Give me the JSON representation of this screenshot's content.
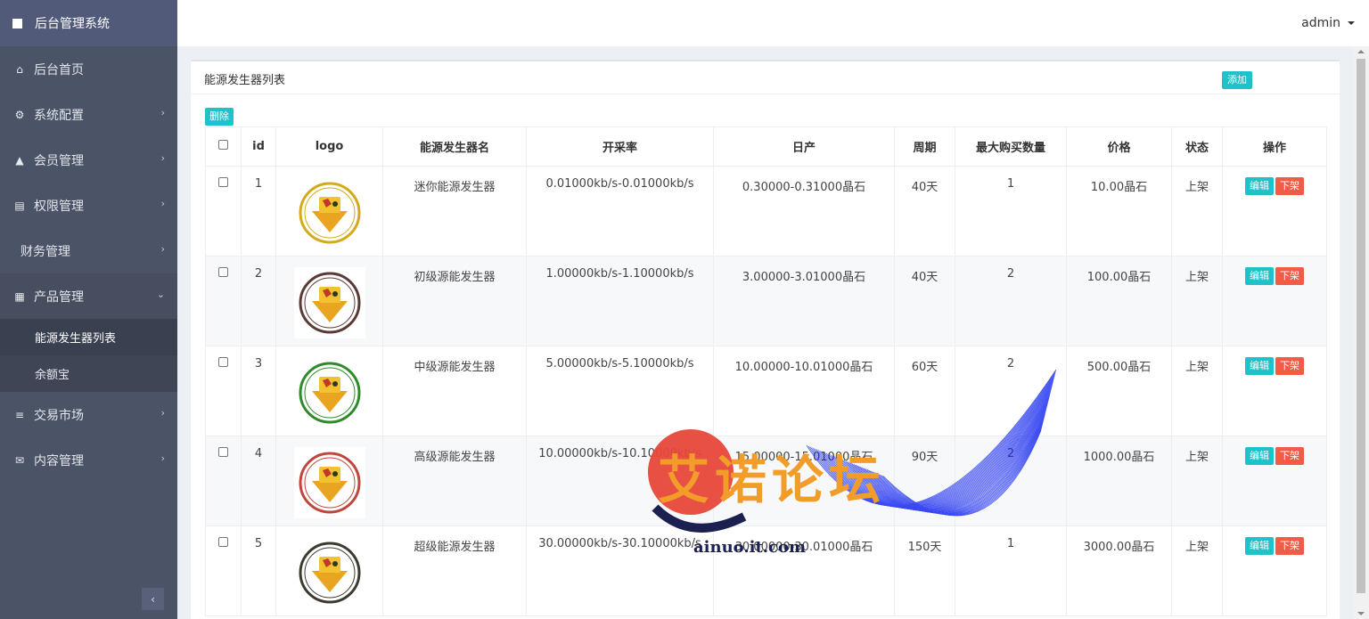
{
  "brand": {
    "title": "后台管理系统"
  },
  "topbar": {
    "user": "admin"
  },
  "sidebar": {
    "items": [
      {
        "label": "后台首页",
        "icon": "home-icon",
        "glyph": "⌂"
      },
      {
        "label": "系统配置",
        "icon": "cogs-icon",
        "glyph": "⚙"
      },
      {
        "label": "会员管理",
        "icon": "user-icon",
        "glyph": "▲"
      },
      {
        "label": "权限管理",
        "icon": "list-icon",
        "glyph": "▤"
      },
      {
        "label": "财务管理",
        "icon": "",
        "glyph": ""
      },
      {
        "label": "产品管理",
        "icon": "windows-icon",
        "glyph": "▦"
      },
      {
        "label": "交易市场",
        "icon": "bars-icon",
        "glyph": "≡"
      },
      {
        "label": "内容管理",
        "icon": "envelope-icon",
        "glyph": "✉"
      }
    ],
    "submenu": [
      {
        "label": "能源发生器列表"
      },
      {
        "label": "余额宝"
      }
    ],
    "collapse": "‹"
  },
  "panel": {
    "title": "能源发生器列表",
    "add_label": "添加",
    "delete_label": "删除"
  },
  "table": {
    "headers": [
      "",
      "id",
      "logo",
      "能源发生器名",
      "开采率",
      "日产",
      "周期",
      "最大购买数量",
      "价格",
      "状态",
      "操作"
    ],
    "edit_label": "编辑",
    "offshelf_label": "下架",
    "rows": [
      {
        "id": "1",
        "name": "迷你能源发生器",
        "rate": "0.01000kb/s-0.01000kb/s",
        "daily": "0.30000-0.31000晶石",
        "period": "40天",
        "max": "1",
        "price": "10.00晶石",
        "status": "上架",
        "ring": "#d4aa1a"
      },
      {
        "id": "2",
        "name": "初级源能发生器",
        "rate": "1.00000kb/s-1.10000kb/s",
        "daily": "3.00000-3.01000晶石",
        "period": "40天",
        "max": "2",
        "price": "100.00晶石",
        "status": "上架",
        "ring": "#5a3a36"
      },
      {
        "id": "3",
        "name": "中级源能发生器",
        "rate": "5.00000kb/s-5.10000kb/s",
        "daily": "10.00000-10.01000晶石",
        "period": "60天",
        "max": "2",
        "price": "500.00晶石",
        "status": "上架",
        "ring": "#2f8a2a"
      },
      {
        "id": "4",
        "name": "高级源能发生器",
        "rate": "10.00000kb/s-10.10000kb/s",
        "daily": "15.00000-15.01000晶石",
        "period": "90天",
        "max": "2",
        "price": "1000.00晶石",
        "status": "上架",
        "ring": "#c0463c"
      },
      {
        "id": "5",
        "name": "超级能源发生器",
        "rate": "30.00000kb/s-30.10000kb/s",
        "daily": "30.00000-30.01000晶石",
        "period": "150天",
        "max": "1",
        "price": "3000.00晶石",
        "status": "上架",
        "ring": "#3d3a30"
      }
    ]
  },
  "watermark": {
    "text": "艾诺论坛",
    "url": "ainuo.it.com"
  },
  "colors": {
    "sidebar": "#4b5366",
    "brand": "#525a7a",
    "teal": "#1fc2c9",
    "red": "#f25c47"
  }
}
